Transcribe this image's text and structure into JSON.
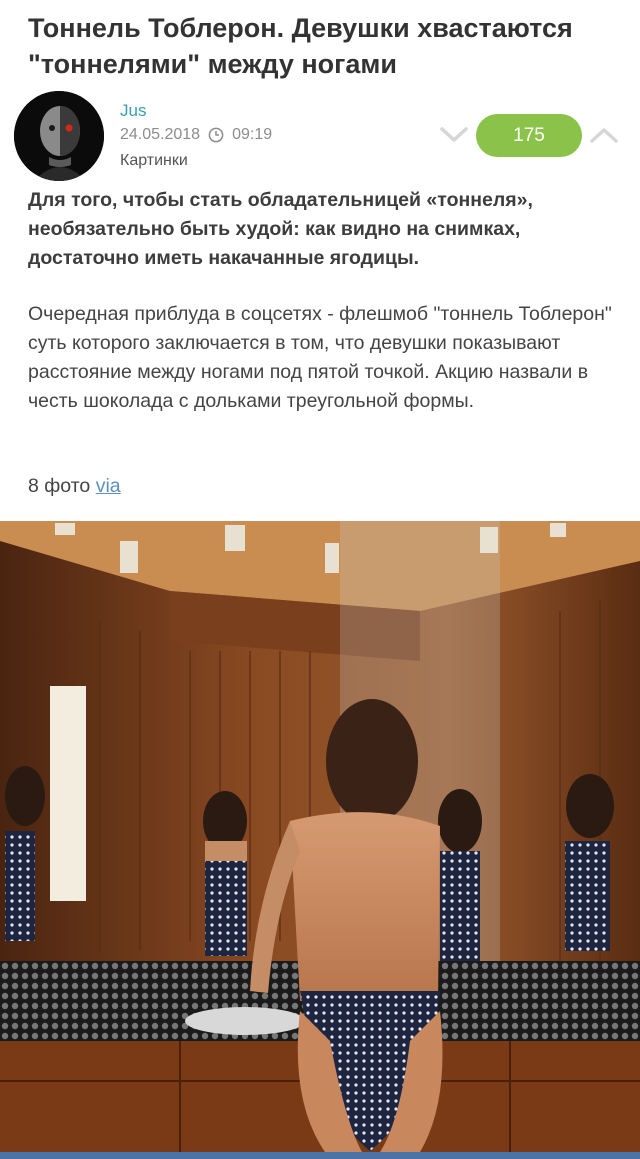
{
  "post": {
    "title": "Тоннель Тоблерон. Девушки хвастаются \"тоннелями\" между ногами",
    "author": "Jus",
    "date": "24.05.2018",
    "time": "09:19",
    "category": "Картинки",
    "score": "175",
    "lead": "Для того, чтобы стать обладательницей «тоннеля», необязательно быть худой: как видно на снимках, достаточно иметь накачанные ягодицы.",
    "body": "Очередная приблуда в соцсетях - флешмоб \"тоннель Тоблерон\" суть которого заключается в том, что девушки показывают расстояние между ногами под пятой точкой. Акцию назвали в честь шоколада с дольками треугольной формы.",
    "photos_count": "8 фото",
    "via_label": "via"
  },
  "icons": {
    "clock": "clock-icon",
    "vote_down": "chevron-down-icon",
    "vote_up": "chevron-up-icon"
  },
  "colors": {
    "author": "#3a9db1",
    "score_bg": "#8bc34a",
    "link": "#5b8fc0",
    "bottom_bar": "#4a74a8"
  }
}
